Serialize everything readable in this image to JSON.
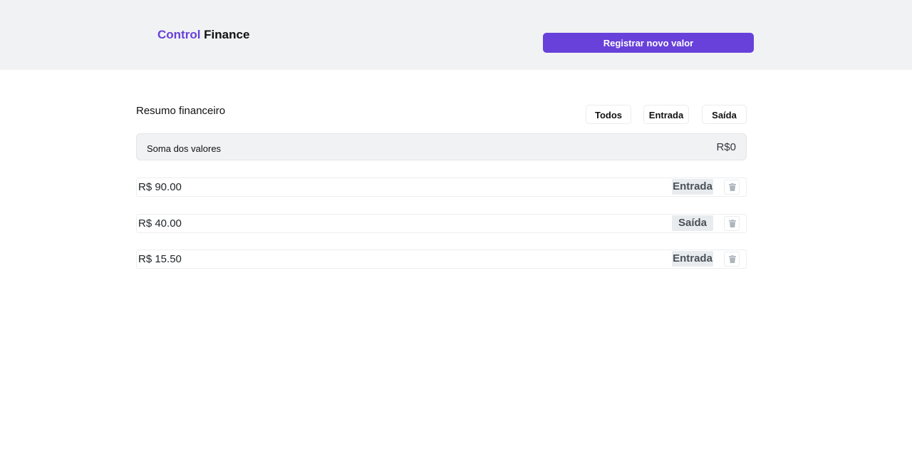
{
  "header": {
    "brand_accent": "Control",
    "brand_rest": "Finance",
    "register_label": "Registrar novo valor"
  },
  "summary": {
    "title": "Resumo financeiro",
    "filters": [
      {
        "label": "Todos"
      },
      {
        "label": "Entrada"
      },
      {
        "label": "Saída"
      }
    ],
    "sum_label": "Soma dos valores",
    "sum_value": "R$0"
  },
  "entries": [
    {
      "value": "R$ 90.00",
      "type": "Entrada"
    },
    {
      "value": "R$ 40.00",
      "type": "Saída"
    },
    {
      "value": "R$ 15.50",
      "type": "Entrada"
    }
  ],
  "colors": {
    "accent": "#6741d9",
    "header_bg": "#f1f2f4",
    "tag_bg": "#e9ecef"
  },
  "icons": {
    "delete": "trash-icon"
  }
}
